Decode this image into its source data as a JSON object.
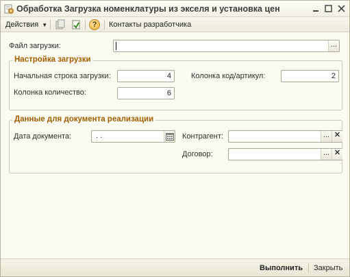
{
  "window": {
    "title": "Обработка  Загрузка номенклатуры из экселя и установка цен"
  },
  "toolbar": {
    "actions_label": "Действия",
    "help_label": "?",
    "developer_contacts_label": "Контакты разработчика"
  },
  "form": {
    "file_label": "Файл загрузки:",
    "file_value": "",
    "select_button": "..."
  },
  "settings_group": {
    "title": "Настройка загрузки",
    "start_row_label": "Начальная строка загрузки:",
    "start_row_value": "4",
    "code_column_label": "Колонка код/артикул:",
    "code_column_value": "2",
    "quantity_column_label": "Колонка количество:",
    "quantity_column_value": "6"
  },
  "document_group": {
    "title": "Данные для документа реализации",
    "date_label": "Дата документа:",
    "date_value": " .  .",
    "counterparty_label": "Контрагент:",
    "counterparty_value": "",
    "contract_label": "Договор:",
    "contract_value": "",
    "select_button": "...",
    "clear_button": "✕"
  },
  "footer": {
    "run_label": "Выполнить",
    "close_label": "Закрыть"
  }
}
